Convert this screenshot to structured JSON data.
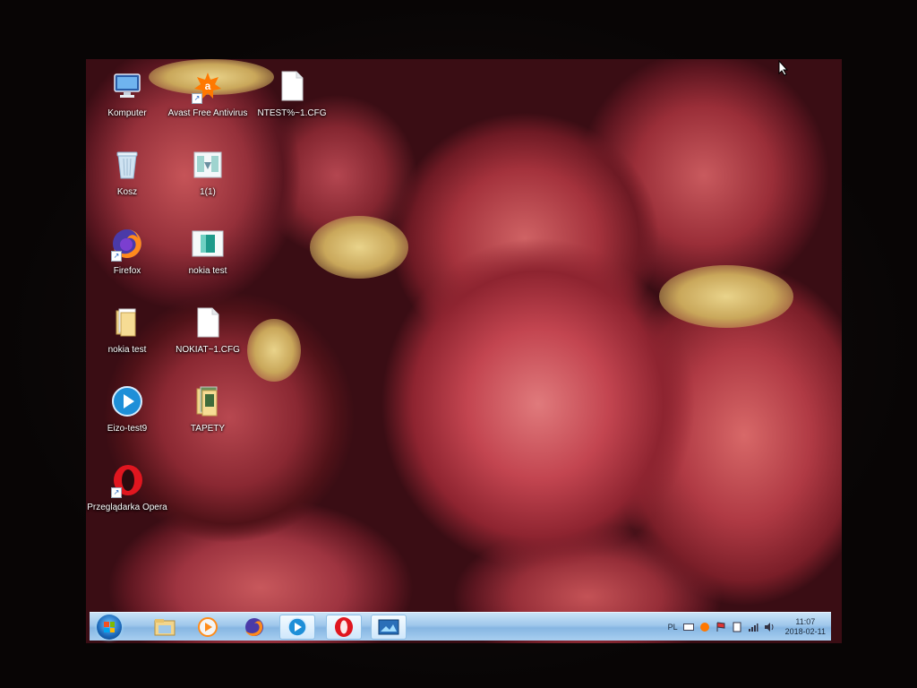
{
  "desktop": {
    "icons": [
      {
        "label": "Komputer",
        "icon": "computer-icon"
      },
      {
        "label": "Avast Free Antivirus",
        "icon": "avast-icon"
      },
      {
        "label": "NTEST%~1.CFG",
        "icon": "file-icon"
      },
      {
        "label": "Kosz",
        "icon": "recycle-bin-icon"
      },
      {
        "label": "1(1)",
        "icon": "image-file-icon"
      },
      {
        "label": "Firefox",
        "icon": "firefox-icon"
      },
      {
        "label": "nokia test",
        "icon": "image-file-icon"
      },
      {
        "label": "nokia test",
        "icon": "folder-icon"
      },
      {
        "label": "NOKIAT~1.CFG",
        "icon": "file-icon"
      },
      {
        "label": "Eizo-test9",
        "icon": "media-player-icon"
      },
      {
        "label": "TAPETY",
        "icon": "folder-icon"
      },
      {
        "label": "Przeglądarka Opera",
        "icon": "opera-icon"
      }
    ],
    "wallpaper": "red-onions",
    "colors": {
      "wallpaper_base": "#3a0d14",
      "taskbar": "#9fc7eb"
    }
  },
  "taskbar": {
    "start_icon": "windows-start-icon",
    "pinned": [
      {
        "name": "explorer",
        "icon": "folder-icon"
      },
      {
        "name": "media-player",
        "icon": "media-player-icon"
      },
      {
        "name": "firefox",
        "icon": "firefox-icon"
      },
      {
        "name": "eizo-player",
        "icon": "media-player-icon"
      },
      {
        "name": "opera",
        "icon": "opera-icon"
      },
      {
        "name": "image-viewer",
        "icon": "image-viewer-icon"
      }
    ],
    "tray": {
      "language": "PL",
      "clock_time": "11:07",
      "clock_date": "2018-02-11"
    }
  }
}
